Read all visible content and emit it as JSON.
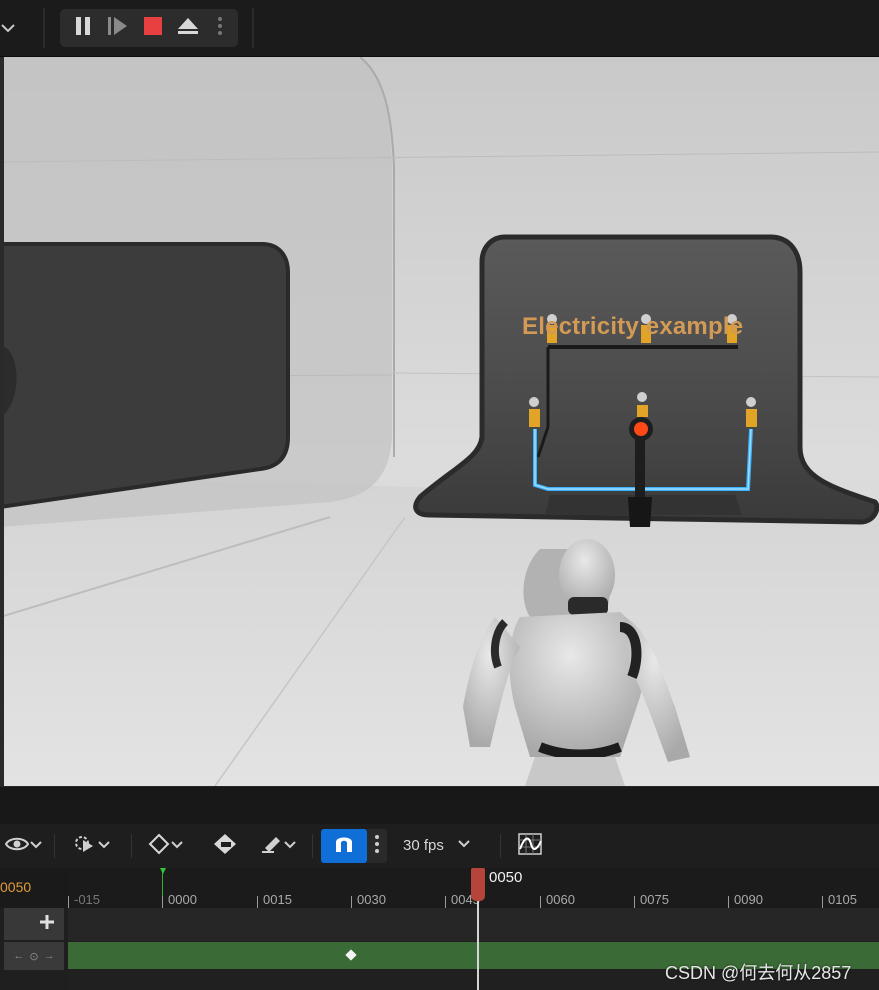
{
  "top_toolbar": {
    "buttons": [
      "pause-icon",
      "step-forward-icon",
      "stop-icon",
      "eject-icon",
      "more-options-icon"
    ]
  },
  "viewport": {
    "sign_text": "Electricity example"
  },
  "sequencer_toolbar": {
    "icons": [
      "eye-icon",
      "playback-options-icon",
      "key-icon",
      "key-auto-icon",
      "edit-brush-icon",
      "snap-magnet-icon",
      "snap-more-icon",
      "curve-editor-icon"
    ],
    "fps": "30 fps",
    "snap_enabled": true
  },
  "timeline": {
    "current_frame": "0050",
    "playhead_label": "0050",
    "ruler": [
      "-015",
      "0000",
      "0015",
      "0030",
      "0045",
      "0060",
      "0075",
      "0090",
      "0105"
    ],
    "add_label": "+",
    "key_nav": [
      "←",
      "⊙",
      "→"
    ]
  },
  "colors": {
    "accent_blue": "#0f6fd6",
    "stop_red": "#e84040",
    "playhead_red": "#b5453a",
    "track_green": "#3a6a35",
    "frame_orange": "#e09a3a",
    "start_green": "#2fb02f",
    "sign_orange": "#d39a55",
    "wire_blue": "#3ab3ff"
  },
  "watermark": "CSDN @何去何从2857"
}
